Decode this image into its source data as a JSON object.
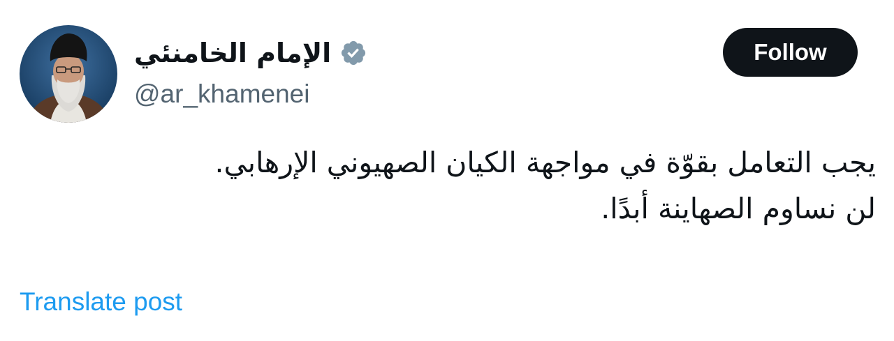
{
  "author": {
    "display_name": "الإمام الخامنئي",
    "handle": "@ar_khamenei",
    "verified": true,
    "verified_badge_color": "#829aab"
  },
  "follow_button": {
    "label": "Follow"
  },
  "post": {
    "lines": [
      "يجب التعامل بقوّة في مواجهة الكيان الصهيوني الإرهابي.",
      "لن نساوم الصهاينة أبدًا."
    ]
  },
  "translate": {
    "label": "Translate post",
    "color": "#1d9bf0"
  },
  "icons": {
    "avatar": "avatar-photo",
    "verified": "verified-badge-icon"
  }
}
